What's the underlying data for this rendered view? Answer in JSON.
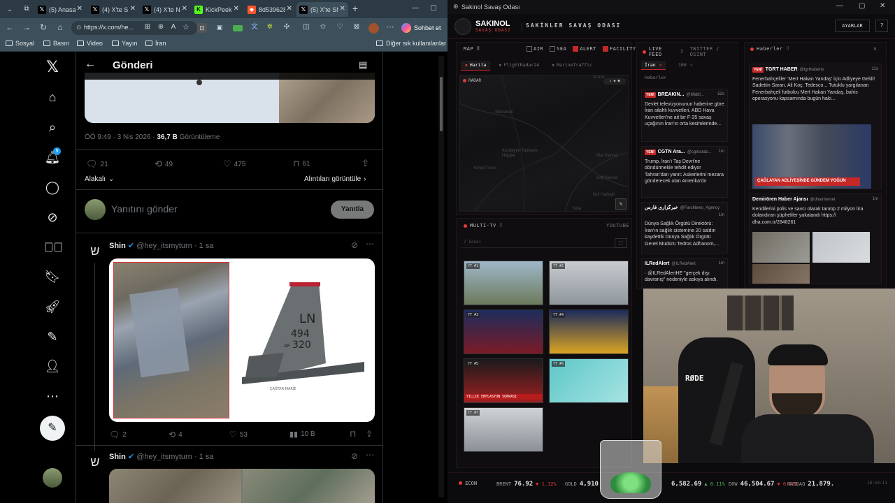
{
  "browser": {
    "tabs": [
      {
        "label": "(5) Anasay",
        "icon": "x-logo"
      },
      {
        "label": "(4) X'te Sı",
        "icon": "x-logo"
      },
      {
        "label": "(4) X'te N",
        "icon": "x-logo"
      },
      {
        "label": "KickPeek",
        "icon": "kick-logo"
      },
      {
        "label": "8d539628",
        "icon": "brave-logo"
      },
      {
        "label": "(5) X'te Sh",
        "icon": "x-logo"
      }
    ],
    "url": "https://x.com/he...",
    "chat_button": "Sohbet et",
    "bookmarks": [
      "Sosyal",
      "Basın",
      "Video",
      "Yayın",
      "İran"
    ],
    "bookmarks_other": "Diğer sık kullanılanlar"
  },
  "twitter": {
    "notif_count": "5",
    "header_title": "Gönderi",
    "post_meta": {
      "time": "ÖÖ 9:49 · 3 Nis 2026 · ",
      "views_num": "36,7 B",
      "views_label": " Görüntüleme"
    },
    "post_actions": {
      "replies": "21",
      "reposts": "49",
      "likes": "475",
      "bookmarks": "61"
    },
    "related_label": "Alakalı",
    "view_quotes": "Alıntıları görüntüle",
    "reply_placeholder": "Yanıtını gönder",
    "reply_button": "Yanıtla",
    "reply1": {
      "name": "Shin",
      "handle": "@hey_itsmyturn · 1 sa",
      "jet_tail_code": "LN",
      "jet_tail_number": "494",
      "jet_tail_af": "AF",
      "jet_tail_serial": "320",
      "watermark": "ÇAĞTAR MARİE",
      "actions": {
        "replies": "2",
        "reposts": "4",
        "likes": "53",
        "views": "10 B"
      }
    },
    "reply2": {
      "name": "Shin",
      "handle": "@hey_itsmyturn · 1 sa"
    }
  },
  "app": {
    "window_title": "Sakinol Savaş Odası",
    "logo_title": "SAKINOL",
    "logo_sub": "SAVAŞ ODASI",
    "header_title": "SAKİNLER SAVAŞ ODASI",
    "settings_button": "AYARLAR",
    "help_button": "?",
    "map": {
      "title": "MAP",
      "drag": "⠿",
      "filters": [
        {
          "label": "AIR",
          "on": false
        },
        {
          "label": "SEA",
          "on": false
        },
        {
          "label": "ALERT",
          "on": true
        },
        {
          "label": "FACILITY",
          "on": true
        }
      ],
      "tabs": [
        "Harita",
        "FlightRadar24",
        "MarineTraffic"
      ],
      "radar_label": "RADAR",
      "places": [
        "Shefaram",
        "Kiryat Tivon",
        "Ka'abiyye-Tabbash-Hajajre",
        "Klar Kanna",
        "Kafr Kanna",
        "Nof HaGalil",
        "Yafia",
        "Ar'ara"
      ]
    },
    "live_feed": {
      "title": "LIVE FEED",
      "subtitle": "TWITTER / OSINT",
      "tabs": [
        "İran",
        "100",
        "Haberler"
      ],
      "cards": [
        {
          "badge": "YENİ",
          "source": "BREAKIN...",
          "handle": "@Middl...",
          "age": "52s",
          "text": "Devlet televizyonunun haberine göre İran silahlı kuvvetleri, ABD Hava Kuvvetleri'ne ait bir F-35 savaş uçağının İran'ın orta kesimlerinde..."
        },
        {
          "badge": "YENİ",
          "source": "CGTN Ara...",
          "handle": "@cgtnarab...",
          "age": "1m",
          "text": "Trump, İran'ı Taş Devri'ne döndürmekle tehdit ediyor Tahran'dan yanıt: Askerlerini mezara gönderecek olan Amerika'dır"
        },
        {
          "badge": "",
          "source": "خبرگزاری فارس",
          "handle": "@FarsNews_Agency",
          "age": "1m",
          "text": "Dünya Sağlık Örgütü Direktörü: İran'ın sağlık sistemine 20 saldırı kaydettik Dünya Sağlık Örgütü Genel Müdürü Tedros Adhanom,..."
        },
        {
          "badge": "",
          "source": "ILRedAlert",
          "handle": "@ILRedAlert",
          "age": "1m",
          "text": "· @ILRedAlertHE \"gerçek dışı davranış\" nedeniyle askıya alındı."
        }
      ]
    },
    "news": {
      "title": "Haberler",
      "cards": [
        {
          "badge": "YENİ",
          "source": "TGRT HABER",
          "handle": "@tgrthabertv",
          "age": "11s",
          "text": "Fenerbahçeliler 'Mert Hakan Yandaş' İçin Adliyeye Geldi! Sadettin Saran, Ali Koç, Tedesco... Tutuklu yargılanan Fenerbahçeli futbolcu Mert Hakan Yandaş, bahis operasyonu kapsamında bugün haki...",
          "image_caption": "ÇAĞLAYAN ADLİYESİNDE GÜNDEM YOĞUN"
        },
        {
          "badge": "",
          "source": "Demirören Haber Ajansı",
          "handle": "@dhainternet",
          "age": "1m",
          "text": "Kendilerini polis ve savcı olarak tanıtıp 2 milyon lira dolandıran şüpheliler yakalandı https:// dha.com.tr/2848261"
        }
      ]
    },
    "multitv": {
      "title": "MULTI-TV",
      "subtitle": "YOUTUBE",
      "search_placeholder": "7 kanal",
      "channels": [
        "YT #1",
        "YT #2",
        "YT #3",
        "YT #4",
        "YT #5",
        "YT #6",
        "YT #7"
      ],
      "captions": [
        "",
        "",
        "",
        "",
        "YILLIK ENFLASYON SONRASI",
        "",
        ""
      ]
    },
    "econ": {
      "title": "ECON",
      "tickers": [
        {
          "name": "BRENT",
          "value": "76.92",
          "change": "▼ 1.12%"
        },
        {
          "name": "GOLD",
          "value": "4,910.",
          "change": ""
        },
        {
          "name": "",
          "value": "6,582.69",
          "change": "▲ 0.11%"
        },
        {
          "name": "DOW",
          "value": "46,504.67",
          "change": "▼ 0.13%"
        },
        {
          "name": "NASDAQ",
          "value": "21,879.",
          "change": ""
        }
      ],
      "clock": "18:58:11"
    },
    "webcam": {
      "mic_brand": "RØDE"
    }
  }
}
